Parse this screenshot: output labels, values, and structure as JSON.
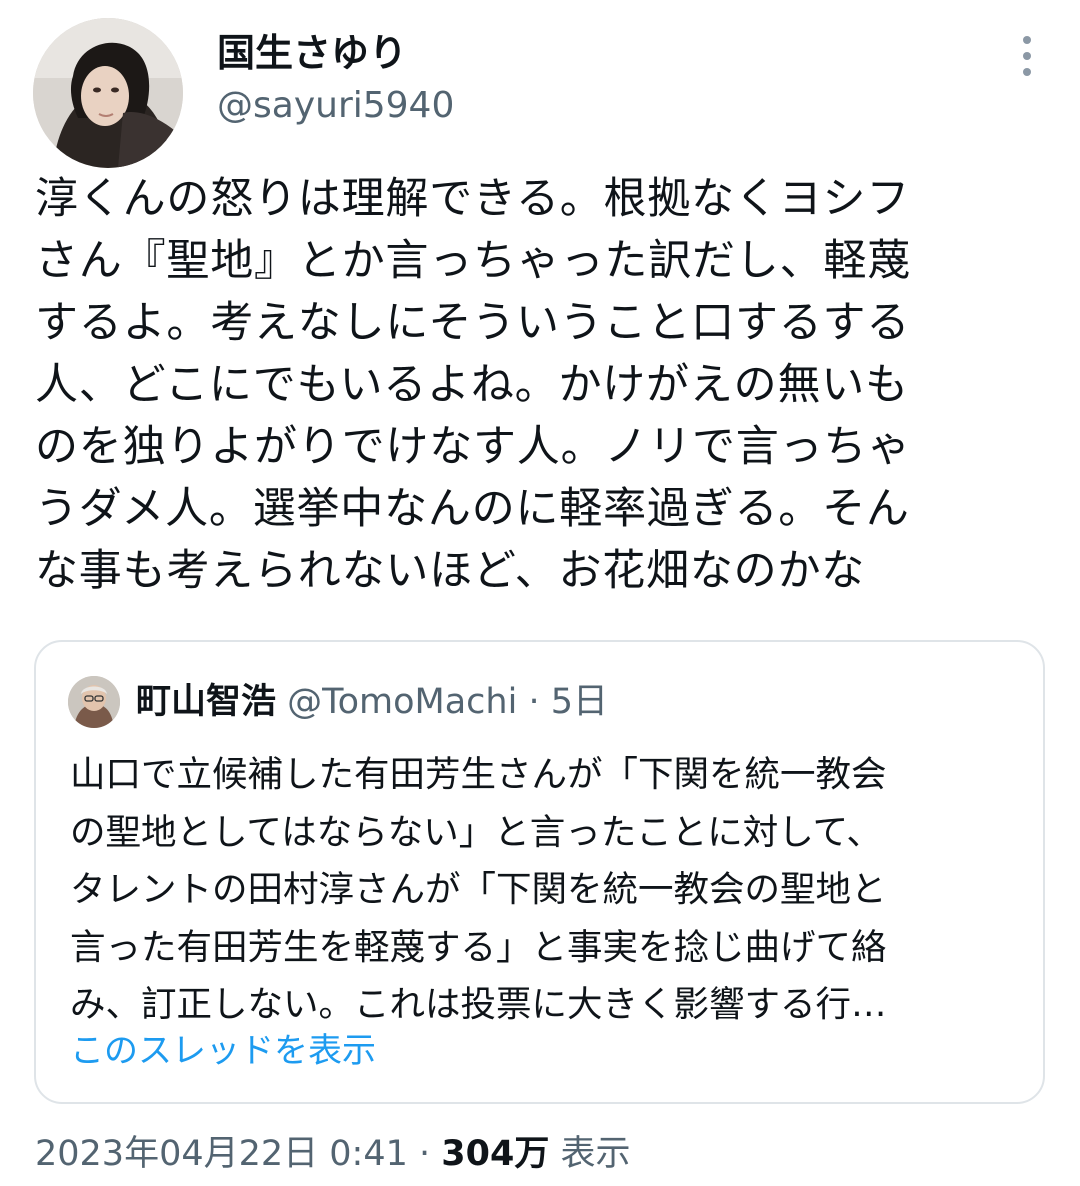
{
  "tweet": {
    "display_name": "国生さゆり",
    "handle": "@sayuri5940",
    "more_icon": "more-dots-vertical-icon",
    "text_lines": [
      "淳くんの怒りは理解できる。根拠なくヨシフ",
      "さん『聖地』とか言っちゃった訳だし、軽蔑",
      "するよ。考えなしにそういうこと口するする",
      "人、どこにでもいるよね。かけがえの無いも",
      "のを独りよがりでけなす人。ノリで言っちゃ",
      "うダメ人。選挙中なんのに軽率過ぎる。そん",
      "な事も考えられないほど、お花畑なのかな"
    ],
    "meta": {
      "timestamp": "2023年04月22日 0:41",
      "separator": " · ",
      "views_count": "304万",
      "views_label": "表示"
    }
  },
  "quote": {
    "name": "町山智浩",
    "handle": "@TomoMachi",
    "separator": " · ",
    "time": "5日",
    "text_lines": [
      "山口で立候補した有田芳生さんが「下関を統一教会",
      "の聖地としてはならない」と言ったことに対して、",
      "タレントの田村淳さんが「下関を統一教会の聖地と",
      "言った有田芳生を軽蔑する」と事実を捻じ曲げて絡",
      "み、訂正しない。これは投票に大きく影響する行…"
    ],
    "thread_link": "このスレッドを表示"
  },
  "colors": {
    "text_primary": "#0f1419",
    "text_secondary": "#536471",
    "link": "#1d9bf0",
    "border": "#dfe4e8"
  }
}
